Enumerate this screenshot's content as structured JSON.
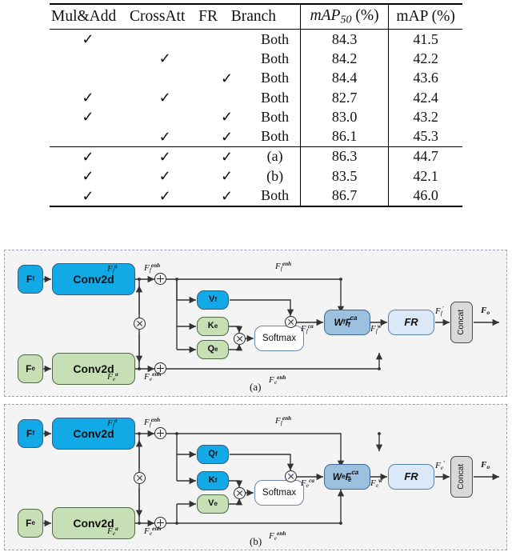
{
  "table": {
    "headers": {
      "mul_add": "Mul&Add",
      "crossatt": "CrossAtt",
      "fr": "FR",
      "branch": "Branch",
      "map50": "mAP",
      "map50_sub": "50",
      "map50_unit": "(%)",
      "map": "mAP (%)"
    },
    "check_glyph": "✓",
    "rows": [
      {
        "mul_add": "✓",
        "crossatt": "",
        "fr": "",
        "branch": "Both",
        "map50": "84.3",
        "map": "41.5",
        "bold": false
      },
      {
        "mul_add": "",
        "crossatt": "✓",
        "fr": "",
        "branch": "Both",
        "map50": "84.2",
        "map": "42.2",
        "bold": false
      },
      {
        "mul_add": "",
        "crossatt": "",
        "fr": "✓",
        "branch": "Both",
        "map50": "84.4",
        "map": "43.6",
        "bold": false
      },
      {
        "mul_add": "✓",
        "crossatt": "✓",
        "fr": "",
        "branch": "Both",
        "map50": "82.7",
        "map": "42.4",
        "bold": false
      },
      {
        "mul_add": "✓",
        "crossatt": "",
        "fr": "✓",
        "branch": "Both",
        "map50": "83.0",
        "map": "43.2",
        "bold": false
      },
      {
        "mul_add": "",
        "crossatt": "✓",
        "fr": "✓",
        "branch": "Both",
        "map50": "86.1",
        "map": "45.3",
        "bold": false
      }
    ],
    "rows2": [
      {
        "mul_add": "✓",
        "crossatt": "✓",
        "fr": "✓",
        "branch": "(a)",
        "map50": "86.3",
        "map": "44.7",
        "bold": false
      },
      {
        "mul_add": "✓",
        "crossatt": "✓",
        "fr": "✓",
        "branch": "(b)",
        "map50": "83.5",
        "map": "42.1",
        "bold": false
      },
      {
        "mul_add": "✓",
        "crossatt": "✓",
        "fr": "✓",
        "branch": "Both",
        "map50": "86.7",
        "map": "46.0",
        "bold": true
      }
    ]
  },
  "colors": {
    "blue": "#11a9e6",
    "green": "#c6dfb4",
    "mid_blue": "#9cc0e0",
    "pale_blue": "#dae8f7",
    "gray": "#d9d9d9",
    "panel_bg": "#f4f4f4",
    "dash_border": "#8fa4c4",
    "line": "#333333"
  },
  "diagram_a": {
    "caption": "(a)",
    "nodes": {
      "ff": "F",
      "ff_sub": "f",
      "fe": "F",
      "fe_sub": "e",
      "conv_top": "Conv2d",
      "conv_bot": "Conv2d",
      "v": "V",
      "v_sub": "f",
      "k": "K",
      "k_sub": "e",
      "q": "Q",
      "q_sub": "e",
      "softmax": "Softmax",
      "w": "W",
      "w_sub": "f",
      "w_f": "F",
      "w_f_sub": "f",
      "w_f_sup": "ca",
      "fr": "FR",
      "concat": "Concat"
    },
    "labels": {
      "fa_top": "F_f^a",
      "fa_bot": "F_e^a",
      "fenh_top": "F_f^enh",
      "fenh_bot": "F_e^enh",
      "fenh_top_long": "F_f^enh",
      "fenh_bot_long": "F_e^enh",
      "fca": "F_f^ca",
      "fw": "F_f^w",
      "fprime": "F_f'",
      "fo": "F_o"
    }
  },
  "diagram_b": {
    "caption": "(b)",
    "nodes": {
      "ff": "F",
      "ff_sub": "f",
      "fe": "F",
      "fe_sub": "e",
      "conv_top": "Conv2d",
      "conv_bot": "Conv2d",
      "q": "Q",
      "q_sub": "f",
      "k": "K",
      "k_sub": "f",
      "v": "V",
      "v_sub": "e",
      "softmax": "Softmax",
      "w": "W",
      "w_sub": "e",
      "w_f": "F",
      "w_f_sub": "e",
      "w_f_sup": "ca",
      "fr": "FR",
      "concat": "Concat"
    },
    "labels": {
      "fa_top": "F_f^a",
      "fa_bot": "F_e^a",
      "fenh_top": "F_f^enh",
      "fenh_bot": "F_e^enh",
      "fca": "F_e^ca",
      "fw": "F_e^w",
      "fprime": "F_e'",
      "fo": "F_o"
    }
  }
}
